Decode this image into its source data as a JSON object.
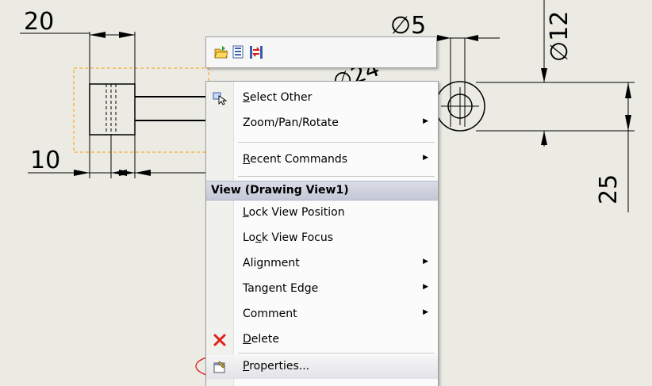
{
  "drawing": {
    "dimensions": {
      "d20": "20",
      "d10": "10",
      "d5": "∅5",
      "d12": "∅12",
      "d25": "25",
      "d24_partial": "∅24"
    }
  },
  "mini_toolbar": {
    "icons": [
      "open-folder-icon",
      "view-palette-icon",
      "swap-icon"
    ]
  },
  "context_menu": {
    "items": [
      {
        "pre": "",
        "accel": "S",
        "post": "elect Other",
        "icon": "select-other-icon",
        "submenu": false
      },
      {
        "pre": "Zoom/Pan/Rotate",
        "accel": "",
        "post": "",
        "icon": "",
        "submenu": true
      },
      {
        "pre": "",
        "accel": "R",
        "post": "ecent Commands",
        "icon": "",
        "submenu": true
      }
    ],
    "section_header": "View (Drawing View1)",
    "view_items": [
      {
        "pre": "",
        "accel": "L",
        "post": "ock View Position",
        "submenu": false
      },
      {
        "pre": "Lo",
        "accel": "c",
        "post": "k View Focus",
        "submenu": false
      },
      {
        "pre": "Alignment",
        "accel": "",
        "post": "",
        "submenu": true
      },
      {
        "pre": "Tangent Edge",
        "accel": "",
        "post": "",
        "submenu": true
      },
      {
        "pre": "Comment",
        "accel": "",
        "post": "",
        "submenu": true
      },
      {
        "pre": "",
        "accel": "D",
        "post": "elete",
        "submenu": false,
        "icon": "delete-x-icon"
      },
      {
        "pre": "",
        "accel": "P",
        "post": "roperties...",
        "submenu": false,
        "icon": "properties-icon"
      }
    ]
  },
  "colors": {
    "canvas": "#ebebe4",
    "selection_box": "#ff9900",
    "highlight_ellipse": "#e02020",
    "delete_icon": "#e0201c"
  }
}
